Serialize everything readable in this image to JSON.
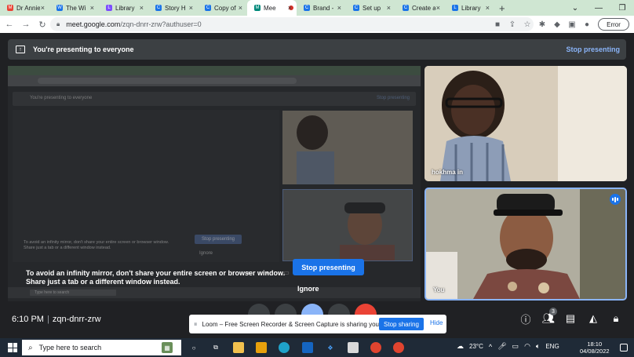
{
  "browser": {
    "tabs": [
      {
        "title": "Dr Annie",
        "color": "#ea4335",
        "glyph": "M"
      },
      {
        "title": "The Wi",
        "color": "#1a73e8",
        "glyph": "W"
      },
      {
        "title": "Library",
        "color": "#7c4dff",
        "glyph": "L"
      },
      {
        "title": "Story H",
        "color": "#1a73e8",
        "glyph": "C"
      },
      {
        "title": "Copy of",
        "color": "#1a73e8",
        "glyph": "C"
      },
      {
        "title": "Mee",
        "color": "#00897b",
        "glyph": "M",
        "active": true
      },
      {
        "title": "Brand -",
        "color": "#1a73e8",
        "glyph": "C"
      },
      {
        "title": "Set up",
        "color": "#1a73e8",
        "glyph": "C"
      },
      {
        "title": "Create a",
        "color": "#1a73e8",
        "glyph": "C"
      },
      {
        "title": "Library",
        "color": "#1a73e8",
        "glyph": "L"
      }
    ],
    "url_host": "meet.google.com",
    "url_path": "/zqn-dnrr-zrw?authuser=0",
    "error_label": "Error"
  },
  "presenting_bar": {
    "text": "You're presenting to everyone",
    "stop_label": "Stop presenting"
  },
  "stage": {
    "warning_line1": "To avoid an infinity mirror, don't share your entire screen or browser window.",
    "warning_line2": "Share just a tab or a different window instead.",
    "stop_button": "Stop presenting",
    "ignore_button": "Ignore"
  },
  "participants": [
    {
      "name": "hokhma in"
    },
    {
      "name": "You"
    }
  ],
  "meeting": {
    "time": "6:10 PM",
    "code": "zqn-dnrr-zrw",
    "people_count": "3"
  },
  "loom": {
    "message": "Loom – Free Screen Recorder & Screen Capture is sharing your screen.",
    "stop_sharing": "Stop sharing",
    "hide": "Hide"
  },
  "taskbar": {
    "search_placeholder": "Type here to search",
    "temperature": "23°C",
    "language": "ENG",
    "time": "18:10",
    "date": "04/08/2022"
  },
  "colors": {
    "accent": "#1a73e8",
    "meet_bg": "#202124",
    "link": "#8ab4f8"
  }
}
